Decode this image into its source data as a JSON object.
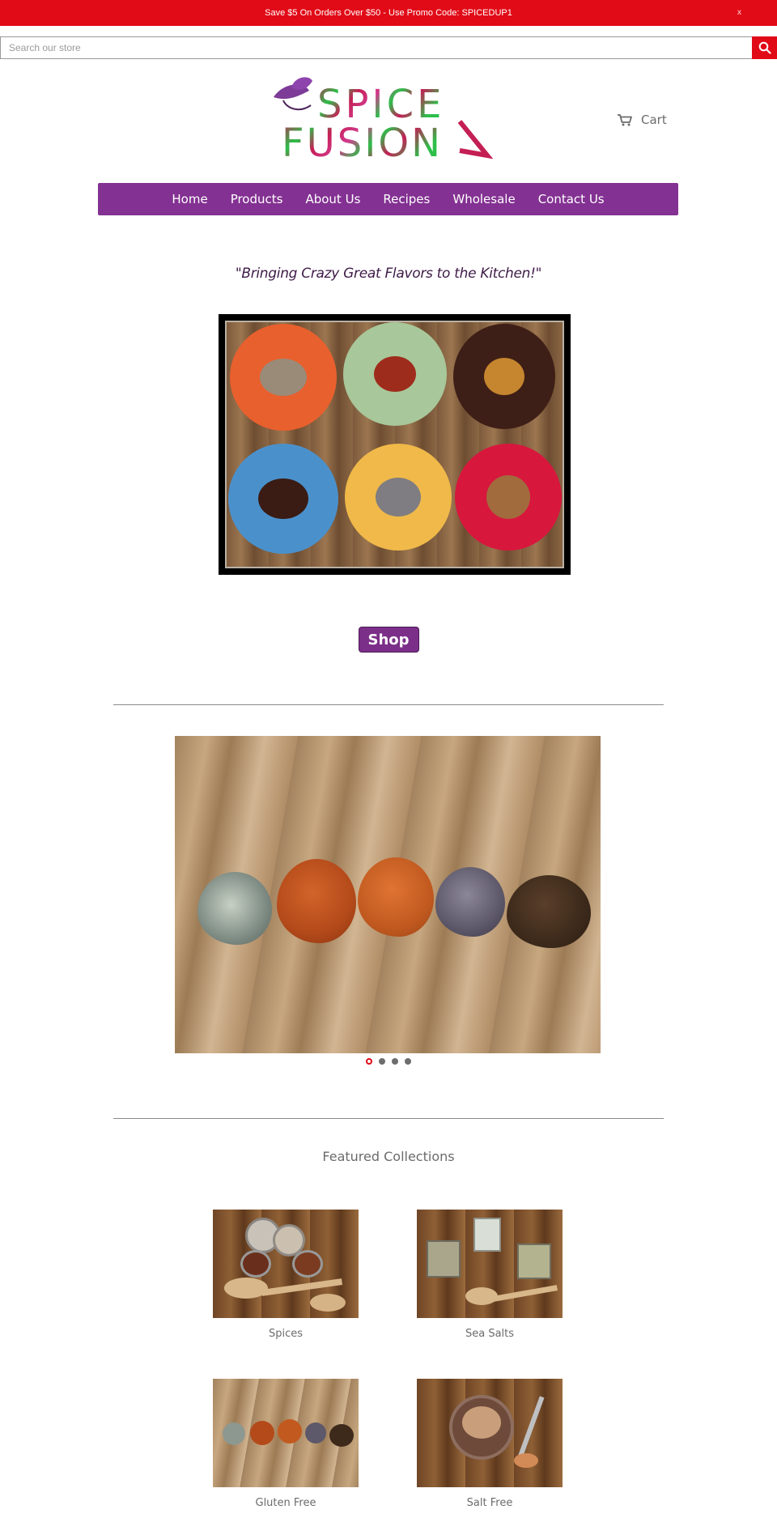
{
  "announcement": {
    "text": "Save $5 On Orders Over $50 - Use Promo Code: SPICEDUP1",
    "dismiss": "x"
  },
  "search": {
    "placeholder": "Search our store",
    "button_icon": "search-icon"
  },
  "logo": {
    "line1": "SPICE",
    "line2": "FUSION"
  },
  "cart": {
    "label": "Cart",
    "icon": "cart-icon"
  },
  "nav": {
    "items": [
      {
        "label": "Home"
      },
      {
        "label": "Products"
      },
      {
        "label": "About Us"
      },
      {
        "label": "Recipes"
      },
      {
        "label": "Wholesale"
      },
      {
        "label": "Contact Us"
      }
    ]
  },
  "tagline": "\"Bringing Crazy Great Flavors to the Kitchen!\"",
  "shop_button": "Shop",
  "slideshow": {
    "slide_count": 4,
    "active_index": 0
  },
  "featured": {
    "title": "Featured Collections",
    "collections": [
      {
        "label": "Spices"
      },
      {
        "label": "Sea Salts"
      },
      {
        "label": "Gluten Free"
      },
      {
        "label": "Salt Free"
      }
    ]
  },
  "colors": {
    "brand_red": "#e10b17",
    "brand_purple": "#833192",
    "tagline_purple": "#3e1b47"
  }
}
